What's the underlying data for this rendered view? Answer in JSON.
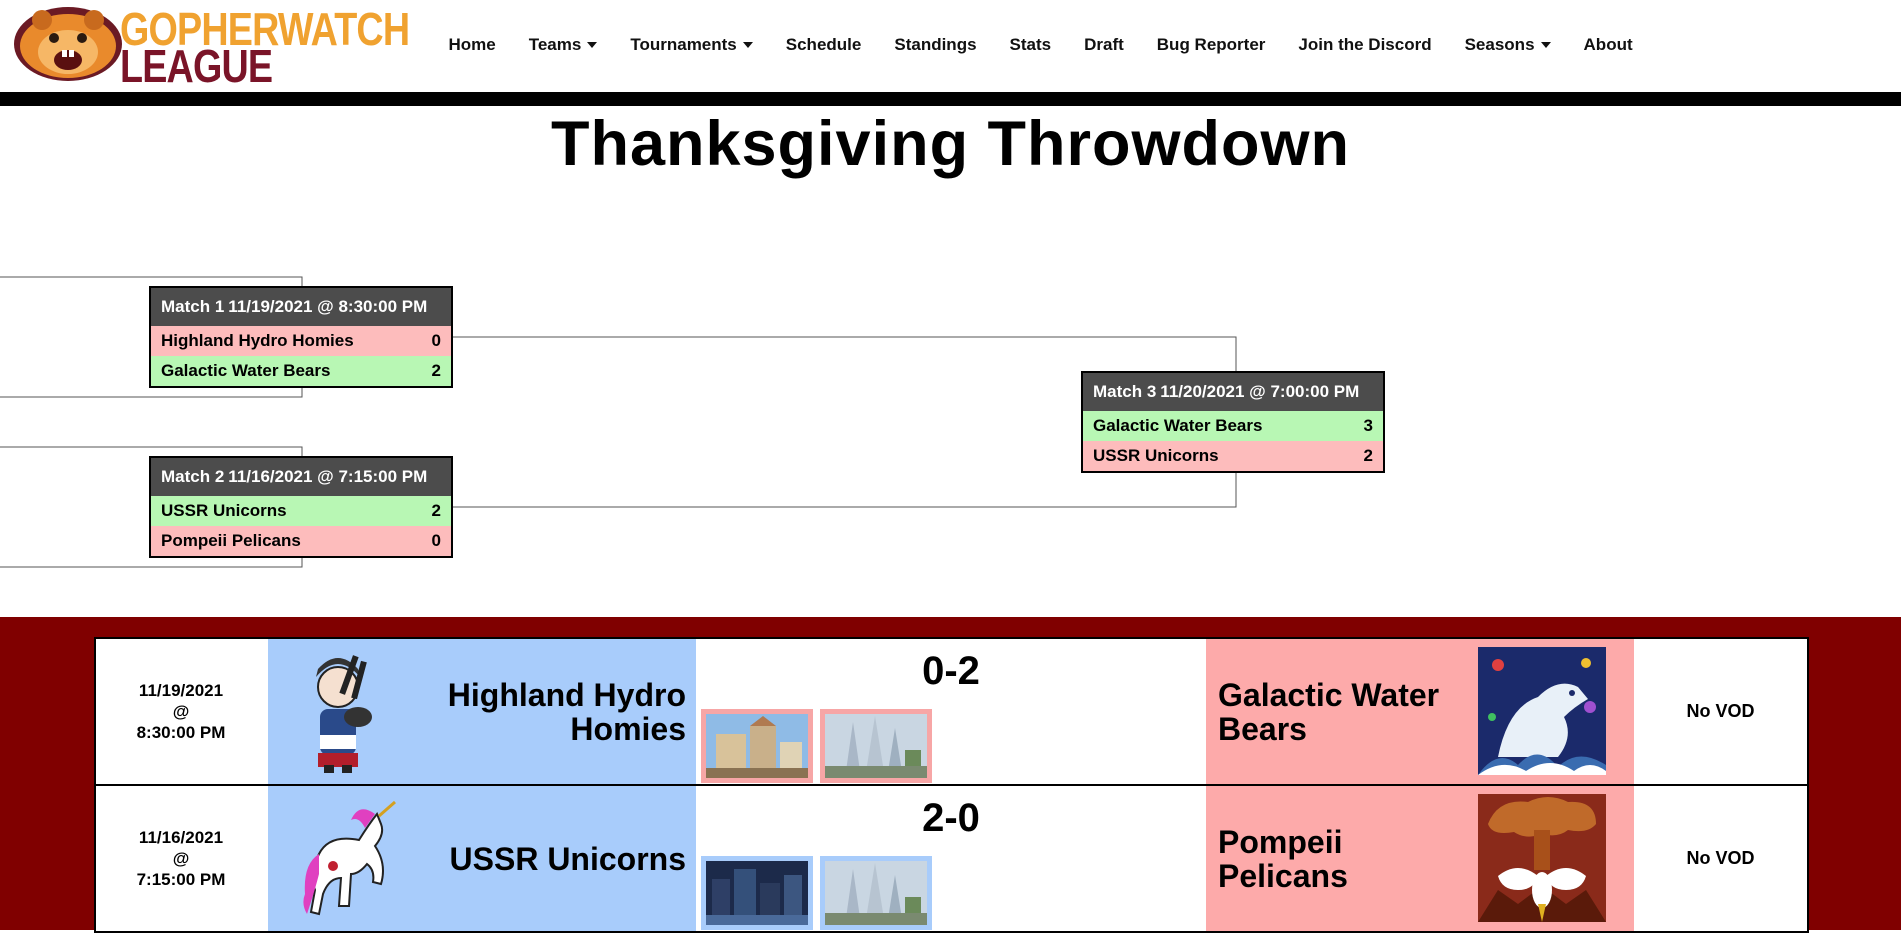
{
  "site": {
    "logo_line1": "GOPHERWATCH",
    "logo_line2": "LEAGUE"
  },
  "nav": {
    "items": [
      {
        "label": "Home",
        "dropdown": false
      },
      {
        "label": "Teams",
        "dropdown": true
      },
      {
        "label": "Tournaments",
        "dropdown": true
      },
      {
        "label": "Schedule",
        "dropdown": false
      },
      {
        "label": "Standings",
        "dropdown": false
      },
      {
        "label": "Stats",
        "dropdown": false
      },
      {
        "label": "Draft",
        "dropdown": false
      },
      {
        "label": "Bug Reporter",
        "dropdown": false
      },
      {
        "label": "Join the Discord",
        "dropdown": false
      },
      {
        "label": "Seasons",
        "dropdown": true
      },
      {
        "label": "About",
        "dropdown": false
      }
    ]
  },
  "page": {
    "title": "Thanksgiving Throwdown"
  },
  "bracket": {
    "matches": [
      {
        "label": "Match 1",
        "datetime": "11/19/2021 @ 8:30:00 PM",
        "teams": [
          {
            "name": "Highland Hydro Homies",
            "score": "0",
            "result": "loss"
          },
          {
            "name": "Galactic Water Bears",
            "score": "2",
            "result": "win"
          }
        ]
      },
      {
        "label": "Match 2",
        "datetime": "11/16/2021 @ 7:15:00 PM",
        "teams": [
          {
            "name": "USSR Unicorns",
            "score": "2",
            "result": "win"
          },
          {
            "name": "Pompeii Pelicans",
            "score": "0",
            "result": "loss"
          }
        ]
      },
      {
        "label": "Match 3",
        "datetime": "11/20/2021 @ 7:00:00 PM",
        "teams": [
          {
            "name": "Galactic Water Bears",
            "score": "3",
            "result": "win"
          },
          {
            "name": "USSR Unicorns",
            "score": "2",
            "result": "loss"
          }
        ]
      }
    ]
  },
  "schedule": {
    "rows": [
      {
        "date": "11/19/2021",
        "at": "@",
        "time": "8:30:00 PM",
        "home": "Highland Hydro Homies",
        "score": "0-2",
        "away": "Galactic Water Bears",
        "vod": "No VOD",
        "map_winner_color": "red"
      },
      {
        "date": "11/16/2021",
        "at": "@",
        "time": "7:15:00 PM",
        "home": "USSR Unicorns",
        "score": "2-0",
        "away": "Pompeii Pelicans",
        "vod": "No VOD",
        "map_winner_color": "blue"
      }
    ]
  },
  "colors": {
    "win": "#b8f7b4",
    "loss": "#fdbcbc",
    "home_bg": "#a8ccfb",
    "away_bg": "#fdaaaa",
    "schedule_bg": "#800000",
    "logo_orange": "#f0a230",
    "logo_maroon": "#7a1428"
  }
}
